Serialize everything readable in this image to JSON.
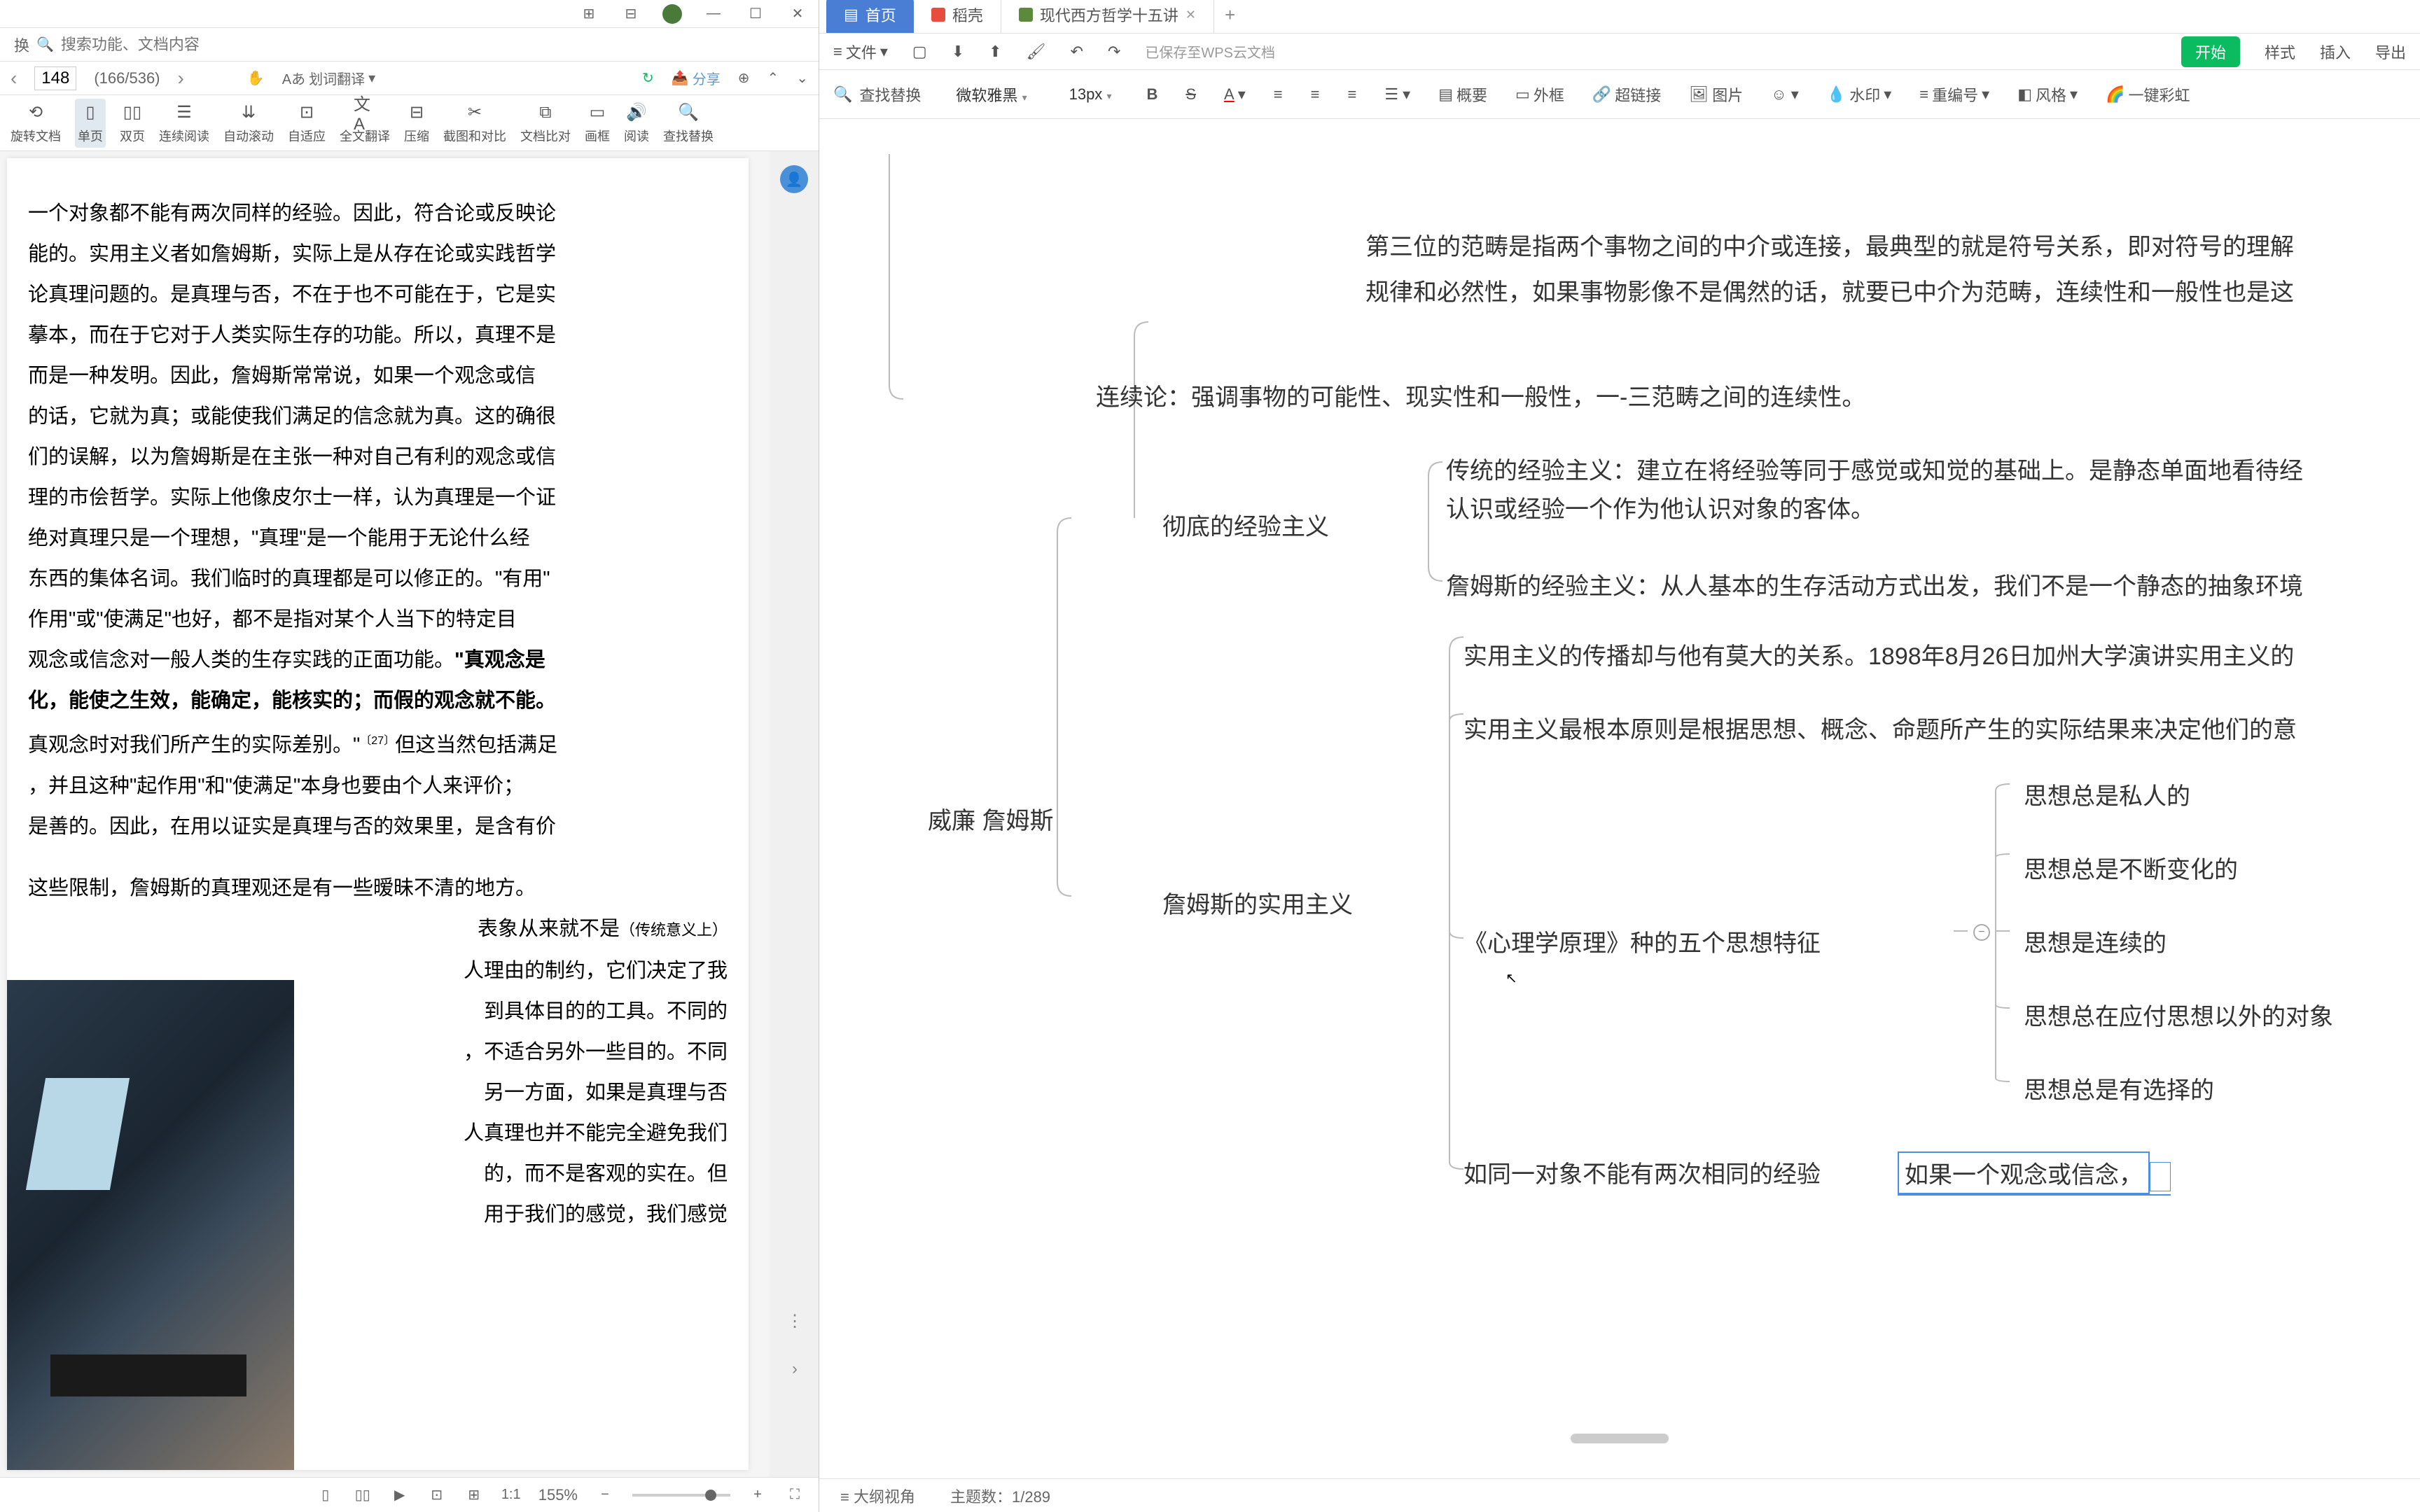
{
  "left": {
    "search_placeholder": "搜索功能、文档内容",
    "page_input": "148",
    "page_count": "(166/536)",
    "toolbar1": {
      "translate": "划词翻译",
      "share": "分享"
    },
    "toolbar2": {
      "rotate": "旋转文档",
      "single": "单页",
      "double": "双页",
      "continuous": "连续阅读",
      "auto": "自动滚动",
      "adapt": "自适应",
      "fulltext": "全文翻译",
      "compress": "压缩",
      "crop": "截图和对比",
      "compare": "文档比对",
      "frame": "画框",
      "read": "阅读",
      "replace": "查找替换"
    },
    "pdf_text": {
      "p1": "一个对象都不能有两次同样的经验。因此，符合论或反映论",
      "p2": "能的。实用主义者如詹姆斯，实际上是从存在论或实践哲学",
      "p3": "论真理问题的。是真理与否，不在于也不可能在于，它是实",
      "p4": "摹本，而在于它对于人类实际生存的功能。所以，真理不是",
      "p5": "而是一种发明。因此，詹姆斯常常说，如果一个观念或信",
      "p6": "的话，它就为真；或能使我们满足的信念就为真。这的确很",
      "p7": "们的误解，以为詹姆斯是在主张一种对自己有利的观念或信",
      "p8": "理的市侩哲学。实际上他像皮尔士一样，认为真理是一个证",
      "p9": "绝对真理只是一个理想，\"真理\"是一个能用于无论什么经",
      "p10": "东西的集体名词。我们临时的真理都是可以修正的。\"有用\"",
      "p11": "作用\"或\"使满足\"也好，都不是指对某个人当下的特定目",
      "p12_a": "观念或信念对一般人类的生存实践的正面功能。",
      "p12_b": "\"真观念是",
      "p13": "化，能使之生效，能确定，能核实的；而假的观念就不能。",
      "p14_a": "真观念时对我们所产生的实际差别。\"",
      "p14_sup": "〔27〕",
      "p14_b": "但这当然包括满足",
      "p15": "，并且这种\"起作用\"和\"使满足\"本身也要由个人来评价；",
      "p16": "是善的。因此，在用以证实是真理与否的效果里，是含有价",
      "p17": "这些限制，詹姆斯的真理观还是有一些暧昧不清的地方。",
      "p18_a": "表象从来就不是",
      "p18_small": "（传统意义上）",
      "p19": "人理由的制约，它们决定了我",
      "p20": "到具体目的的工具。不同的",
      "p21": "，不适合另外一些目的。不同",
      "p22": "另一方面，如果是真理与否",
      "p23": "人真理也并不能完全避免我们",
      "p24": "的，而不是客观的实在。但",
      "p25": "用于我们的感觉，我们感觉"
    },
    "zoom": "155%"
  },
  "right": {
    "tabs": {
      "home": "首页",
      "app": "稻壳",
      "doc": "现代西方哲学十五讲"
    },
    "toolbar1": {
      "file": "文件",
      "replace": "查找替换",
      "save_status": "已保存至WPS云文档",
      "start": "开始",
      "style": "样式",
      "insert": "插入",
      "export": "导出"
    },
    "toolbar2": {
      "font": "微软雅黑",
      "size": "13px",
      "summary": "概要",
      "frame": "外框",
      "link": "超链接",
      "image": "图片",
      "watermark": "水印",
      "renumber": "重编号",
      "grid": "风格",
      "rainbow": "一键彩虹"
    },
    "mindmap": {
      "n_top1": "第三位的范畴是指两个事物之间的中介或连接，最典型的就是符号关系，即对符号的理解",
      "n_top2": "规律和必然性，如果事物影像不是偶然的话，就要已中介为范畴，连续性和一般性也是这",
      "n_continuity": "连续论：强调事物的可能性、现实性和一般性，一-三范畴之间的连续性。",
      "n_thorough": "彻底的经验主义",
      "n_traditional": "传统的经验主义：建立在将经验等同于感觉或知觉的基础上。是静态单面地看待经",
      "n_traditional2": "认识或经验一个作为他认识对象的客体。",
      "n_james_emp": "詹姆斯的经验主义：从人基本的生存活动方式出发，我们不是一个静态的抽象环境",
      "n_williams": "威廉 詹姆斯",
      "n_pragmatism": "詹姆斯的实用主义",
      "n_spread": "实用主义的传播却与他有莫大的关系。1898年8月26日加州大学演讲实用主义的",
      "n_principle": "实用主义最根本原则是根据思想、概念、命题所产生的实际结果来决定他们的意",
      "n_psych": "《心理学原理》种的五个思想特征",
      "n_t1": "思想总是私人的",
      "n_t2": "思想总是不断变化的",
      "n_t3": "思想是连续的",
      "n_t4": "思想总在应付思想以外的对象",
      "n_t5": "思想总是有选择的",
      "n_same": "如同一对象不能有两次相同的经验",
      "n_edit": "如果一个观念或信念，"
    },
    "statusbar": {
      "view": "大纲视角",
      "topic": "主题数：",
      "count": "1/289"
    }
  },
  "换": "换"
}
